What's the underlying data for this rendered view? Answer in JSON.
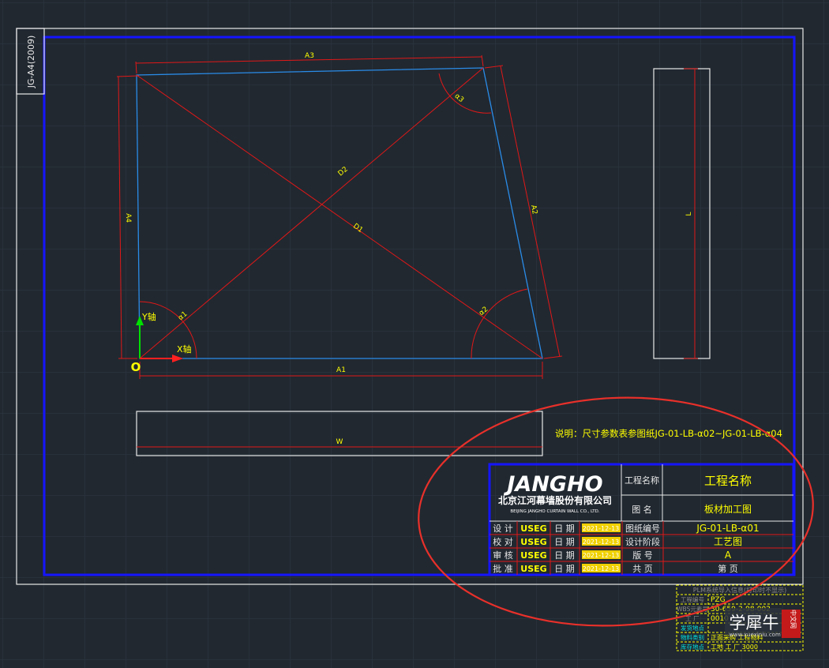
{
  "sheet": {
    "frame_label": "JG-A4(2009)"
  },
  "drawing": {
    "dimensions": {
      "a1": "A1",
      "a2": "A2",
      "a3": "A3",
      "a4": "A4",
      "d1": "D1",
      "d2": "D2",
      "l": "L",
      "w": "W"
    },
    "angles": {
      "alpha1": "α1",
      "alpha2": "α2",
      "alpha3": "α3"
    },
    "axes": {
      "y": "Y轴",
      "x": "X轴",
      "origin": "O"
    }
  },
  "note": "说明：尺寸参数表参图纸JG-01-LB-α02~JG-01-LB-α04",
  "title_block": {
    "logo_main": "JANGHO",
    "logo_cn": "北京江河幕墙股份有限公司",
    "logo_en": "BEIJING JANGHO CURTAIN WALL CO., LTD.",
    "project_name_label": "工程名称",
    "project_name_value": "工程名称",
    "drawing_name_label": "图    名",
    "drawing_name_value": "板材加工图",
    "rows": [
      {
        "role": "设  计",
        "person": "USEG",
        "date_label": "日  期",
        "date": "2021-12-13",
        "field": "图纸编号",
        "value": "JG-01-LB-α01"
      },
      {
        "role": "校  对",
        "person": "USEG",
        "date_label": "日  期",
        "date": "2021-12-13",
        "field": "设计阶段",
        "value": "工艺图"
      },
      {
        "role": "审  核",
        "person": "USEG",
        "date_label": "日  期",
        "date": "2021-12-13",
        "field": "版    号",
        "value": "A"
      },
      {
        "role": "批  准",
        "person": "USEG",
        "date_label": "日  期",
        "date": "2021-12-13",
        "field": "共    页",
        "value": "第    页"
      }
    ]
  },
  "plm_block": {
    "title": "PLM系统导入信息(打印时不显示)",
    "rows": [
      {
        "label": "工程编号",
        "value": "PZG"
      },
      {
        "label": "WBS元素号",
        "value": "30-659-2-98-002"
      },
      {
        "label": "工  厂",
        "value": "0010"
      },
      {
        "label": "发货地点",
        "value": ""
      },
      {
        "label": "物料类别",
        "value": "正面采购  工程物料"
      },
      {
        "label": "库存地点",
        "value": "工地    工    厂    3000"
      }
    ]
  },
  "watermark": {
    "text": "学犀牛",
    "badge": "中文网",
    "url": "www.xuexiniu.com"
  },
  "colors": {
    "background": "#212830",
    "frame_white": "#ffffff",
    "frame_blue": "#1515ff",
    "dim_red": "#e01818",
    "panel_blue": "#2a8ce8",
    "text_yellow": "#ffff00",
    "highlight_ellipse": "#e8302a"
  }
}
